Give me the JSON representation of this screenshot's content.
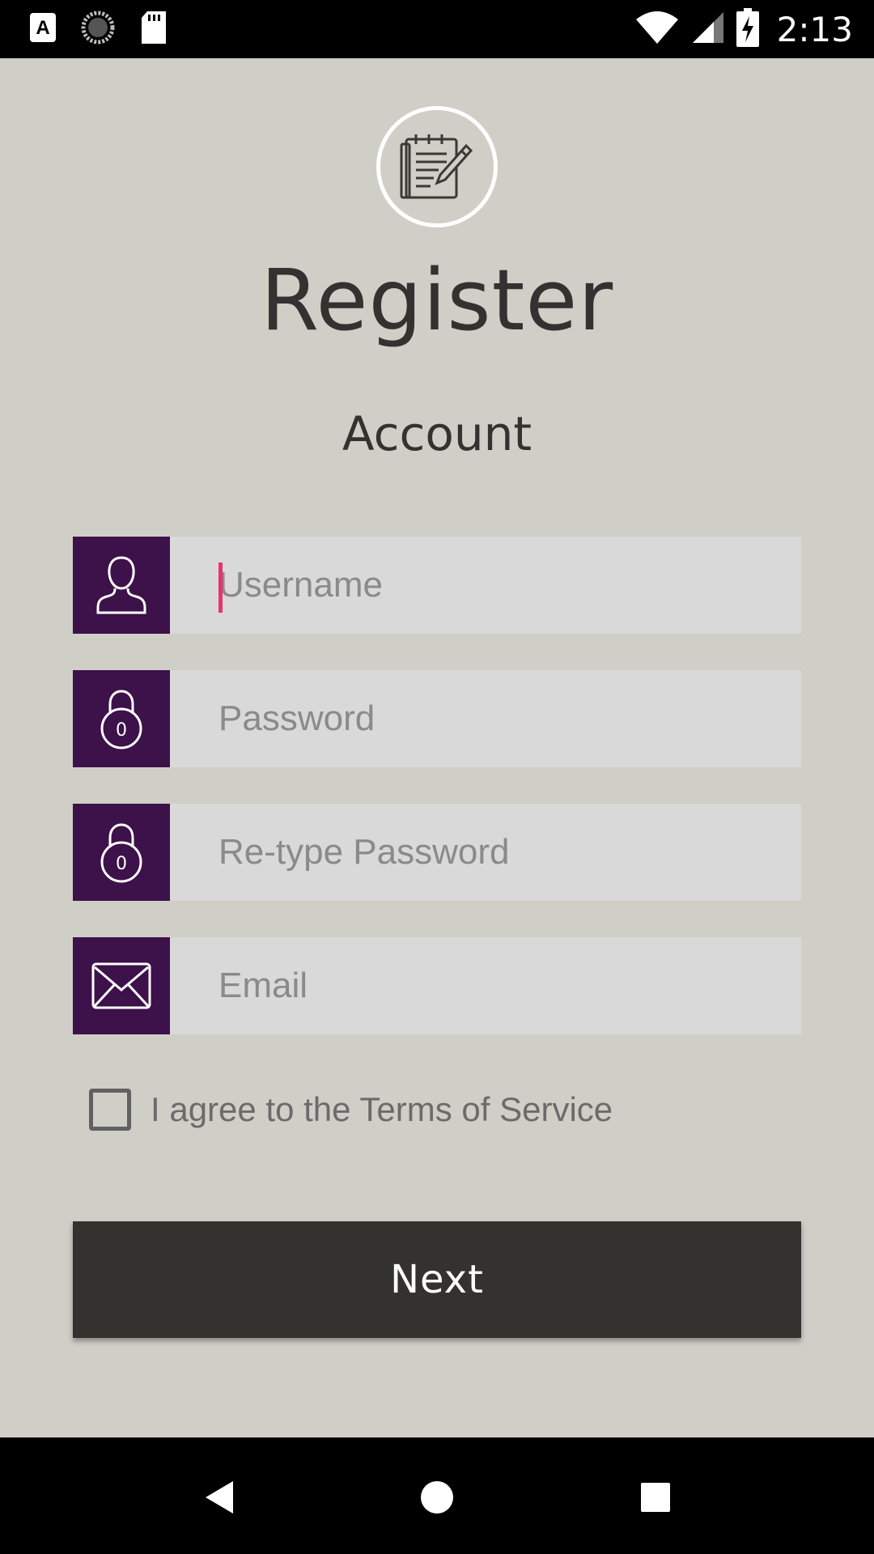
{
  "status_bar": {
    "time": "2:13",
    "left_icons": [
      "app-a-icon",
      "sync-icon",
      "sd-card-icon"
    ],
    "right_icons": [
      "wifi-icon",
      "cellular-signal-icon",
      "battery-charging-icon"
    ]
  },
  "header": {
    "logo_icon": "notepad-pencil-icon",
    "title": "Register",
    "subtitle": "Account"
  },
  "form": {
    "username": {
      "placeholder": "Username",
      "value": "",
      "icon": "user-icon"
    },
    "password": {
      "placeholder": "Password",
      "value": "",
      "icon": "lock-icon"
    },
    "retype_password": {
      "placeholder": "Re-type Password",
      "value": "",
      "icon": "lock-icon"
    },
    "email": {
      "placeholder": "Email",
      "value": "",
      "icon": "mail-icon"
    },
    "terms": {
      "label": "I agree to the Terms of Service",
      "checked": false
    },
    "next_label": "Next"
  },
  "colors": {
    "background": "#cfcec7",
    "icon_tile": "#3d1149",
    "input_bg": "#d9d9d9",
    "button_bg": "#33322f",
    "caret": "#e8336f"
  },
  "nav_bar": {
    "buttons": [
      "back-icon",
      "home-icon",
      "recents-icon"
    ]
  }
}
